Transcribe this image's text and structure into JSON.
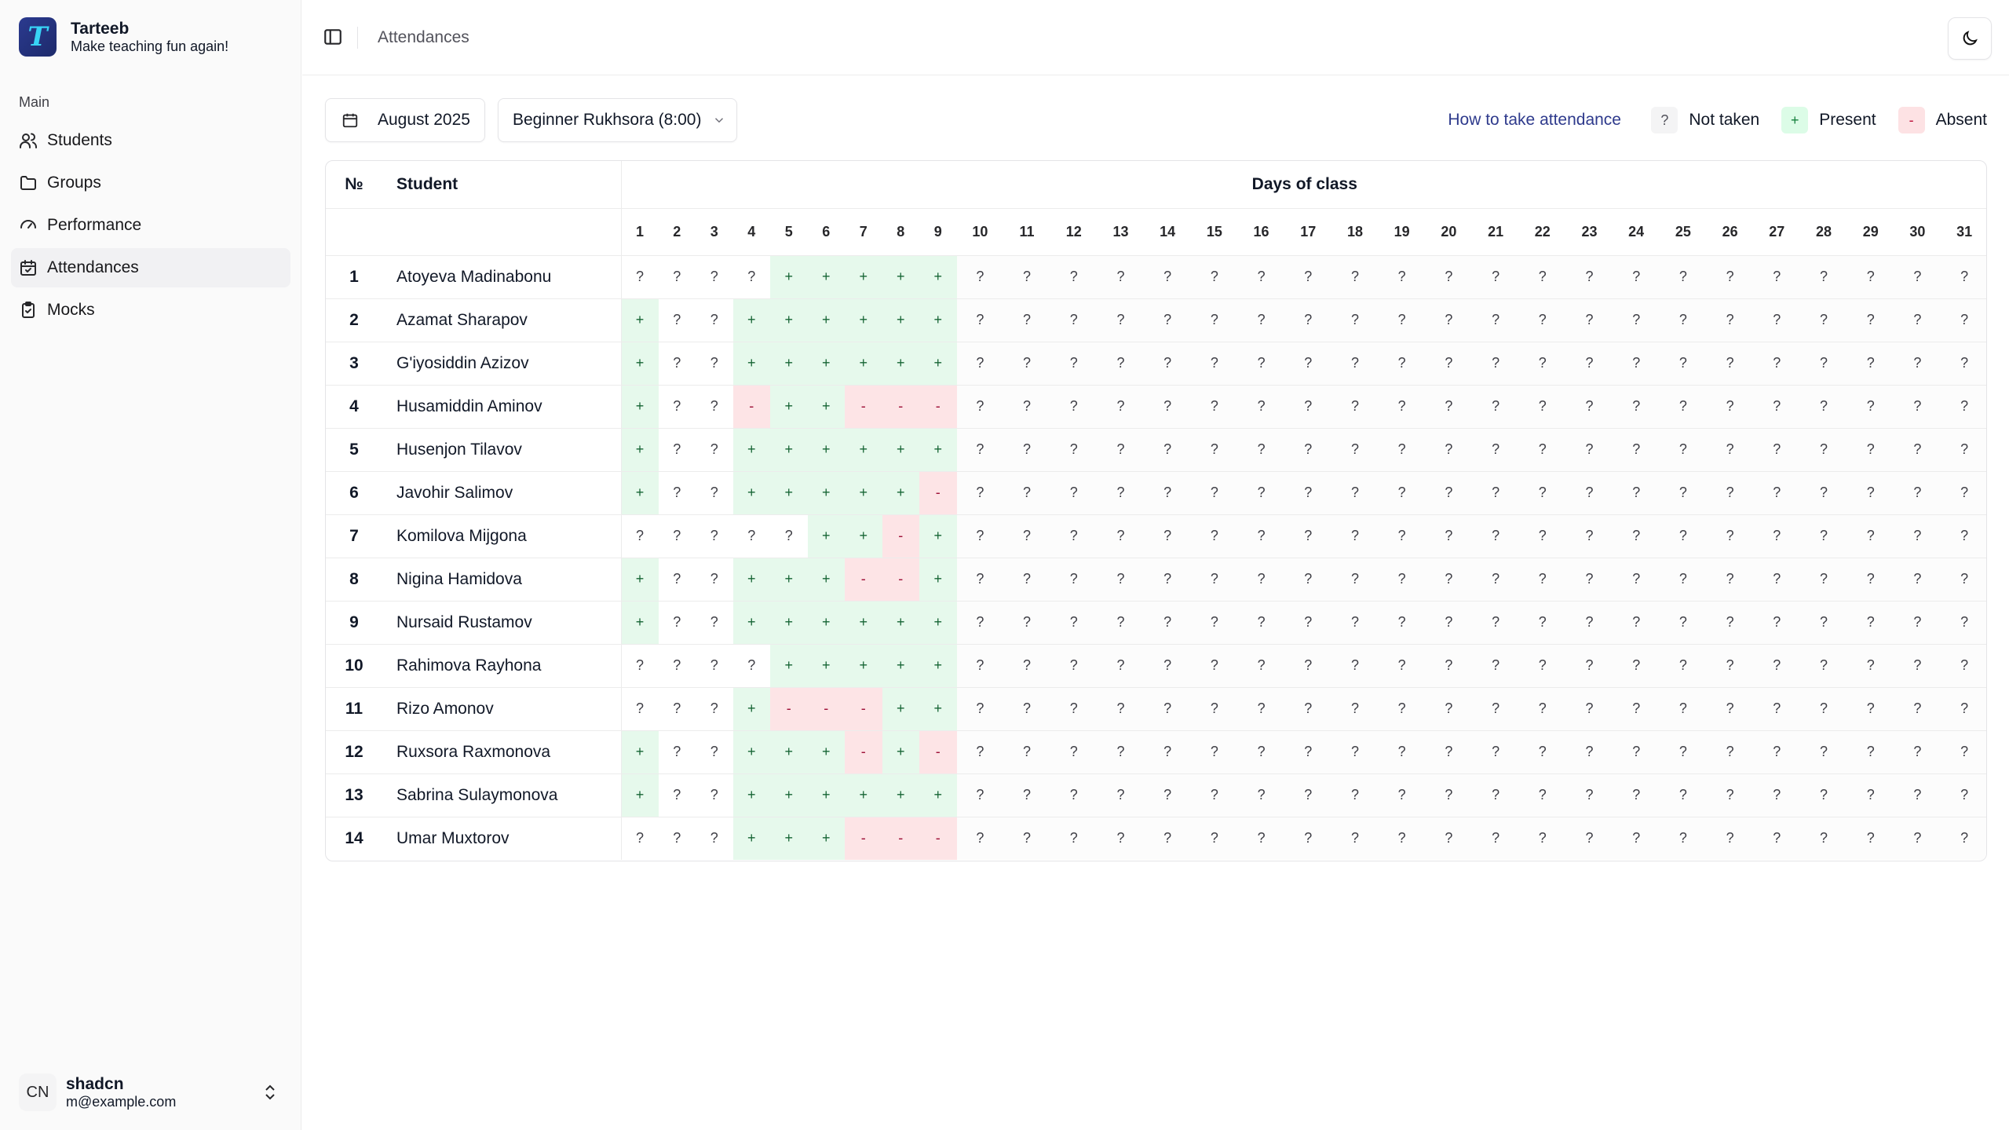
{
  "app": {
    "name": "Tarteeb",
    "tagline": "Make teaching fun again!",
    "logo_letter": "T"
  },
  "sidebar": {
    "section_label": "Main",
    "items": [
      {
        "label": "Students",
        "icon": "users-icon"
      },
      {
        "label": "Groups",
        "icon": "folder-icon"
      },
      {
        "label": "Performance",
        "icon": "gauge-icon"
      },
      {
        "label": "Attendances",
        "icon": "calendar-check-icon",
        "active": true
      },
      {
        "label": "Mocks",
        "icon": "clipboard-check-icon"
      }
    ],
    "user": {
      "initials": "CN",
      "name": "shadcn",
      "email": "m@example.com"
    }
  },
  "header": {
    "breadcrumb": "Attendances"
  },
  "toolbar": {
    "month": "August 2025",
    "group": "Beginner Rukhsora (8:00)",
    "help_link": "How to take attendance",
    "legend": [
      {
        "symbol": "?",
        "label": "Not taken"
      },
      {
        "symbol": "+",
        "label": "Present"
      },
      {
        "symbol": "-",
        "label": "Absent"
      }
    ]
  },
  "colors": {
    "present_bg": "#e6f9ec",
    "absent_bg": "#fde4e6",
    "link": "#2e3a8c"
  },
  "table": {
    "col_no": "№",
    "col_student": "Student",
    "days_header": "Days of class",
    "days": [
      "1",
      "2",
      "3",
      "4",
      "5",
      "6",
      "7",
      "8",
      "9",
      "10",
      "11",
      "12",
      "13",
      "14",
      "15",
      "16",
      "17",
      "18",
      "19",
      "20",
      "21",
      "22",
      "23",
      "24",
      "25",
      "26",
      "27",
      "28",
      "29",
      "30",
      "31"
    ],
    "rows": [
      {
        "no": "1",
        "name": "Atoyeva Madinabonu",
        "marks": "????+++++"
      },
      {
        "no": "2",
        "name": "Azamat Sharapov",
        "marks": "+??++++++"
      },
      {
        "no": "3",
        "name": "G'iyosiddin Azizov",
        "marks": "+??++++++"
      },
      {
        "no": "4",
        "name": "Husamiddin Aminov",
        "marks": "+??-++---"
      },
      {
        "no": "5",
        "name": "Husenjon Tilavov",
        "marks": "+??++++++"
      },
      {
        "no": "6",
        "name": "Javohir Salimov",
        "marks": "+??+++++-"
      },
      {
        "no": "7",
        "name": "Komilova Mijgona",
        "marks": "?????++-+"
      },
      {
        "no": "8",
        "name": "Nigina Hamidova",
        "marks": "+??+++--+"
      },
      {
        "no": "9",
        "name": "Nursaid Rustamov",
        "marks": "+??++++++"
      },
      {
        "no": "10",
        "name": "Rahimova Rayhona",
        "marks": "????+++++"
      },
      {
        "no": "11",
        "name": "Rizo Amonov",
        "marks": "???+---++"
      },
      {
        "no": "12",
        "name": "Ruxsora Raxmonova",
        "marks": "+??+++-+-"
      },
      {
        "no": "13",
        "name": "Sabrina Sulaymonova",
        "marks": "+??++++++"
      },
      {
        "no": "14",
        "name": "Umar Muxtorov",
        "marks": "???+++---"
      }
    ]
  }
}
